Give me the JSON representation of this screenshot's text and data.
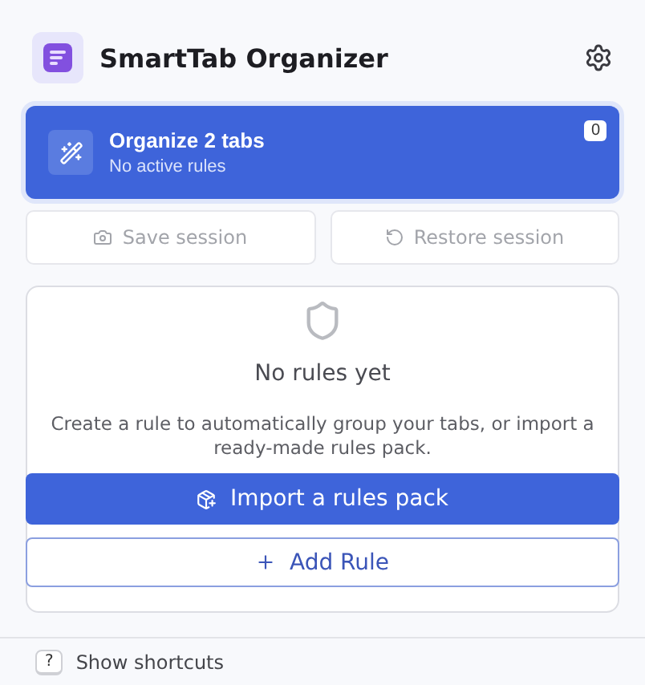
{
  "header": {
    "title": "SmartTab Organizer"
  },
  "organize": {
    "title": "Organize 2 tabs",
    "subtitle": "No active rules",
    "badge": "0"
  },
  "session_buttons": [
    {
      "kind": "save",
      "label": "Save session",
      "disabled": true
    },
    {
      "kind": "restore",
      "label": "Restore session",
      "disabled": true
    }
  ],
  "rules": {
    "empty_title": "No rules yet",
    "empty_text": "Create a rule to automatically group your tabs, or import a ready-made rules pack.",
    "import_button": "Import a rules pack",
    "add_button": "Add Rule"
  },
  "footer": {
    "key": "?",
    "label": "Show shortcuts"
  }
}
